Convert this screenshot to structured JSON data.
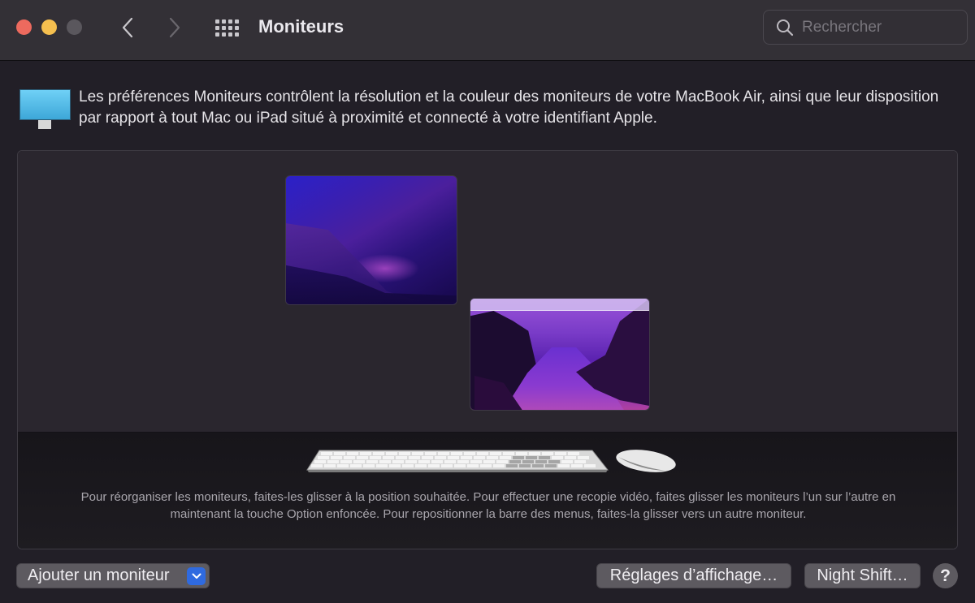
{
  "window": {
    "title": "Moniteurs",
    "traffic_lights": {
      "close": "#ed6a5e",
      "minimize": "#f5bf4f",
      "maximize": "#5a575d"
    },
    "nav": {
      "back_icon": "chevron-left-icon",
      "forward_icon": "chevron-right-icon",
      "grid_icon": "grid-icon"
    }
  },
  "search": {
    "placeholder": "Rechercher",
    "value": "",
    "icon": "search-icon"
  },
  "description": {
    "icon": "display-icon",
    "text": "Les préférences Moniteurs contrôlent la résolution et la couleur des moniteurs de votre MacBook Air, ainsi que leur disposition par rapport à tout Mac ou iPad situé à proximité et connecté à votre identifiant Apple."
  },
  "arrangement": {
    "displays": [
      {
        "name": "primary-display",
        "wallpaper": "Monterey dark",
        "has_menu_bar": false
      },
      {
        "name": "secondary-display",
        "wallpaper": "Big Sur valley",
        "has_menu_bar": true
      }
    ],
    "help_text": "Pour réorganiser les moniteurs, faites-les glisser à la position souhaitée. Pour effectuer une recopie vidéo, faites glisser les moniteurs l’un sur l’autre en maintenant la touche Option enfoncée. Pour repositionner la barre des menus, faites-la glisser vers un autre moniteur."
  },
  "buttons": {
    "add_monitor": "Ajouter un moniteur",
    "display_settings": "Réglages d’affichage…",
    "night_shift": "Night Shift…",
    "help": "?"
  },
  "colors": {
    "accent": "#2f6ae0",
    "background": "#221f27",
    "titlebar": "#333036"
  }
}
